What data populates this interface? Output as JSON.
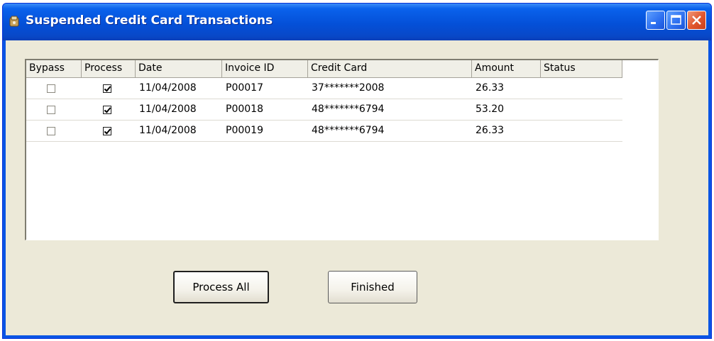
{
  "window": {
    "title": "Suspended Credit Card Transactions",
    "titlebar_color": "#0a55e4",
    "client_bg": "#ece9d8"
  },
  "titlebar_buttons": {
    "minimize_icon": "minimize-icon",
    "maximize_icon": "maximize-icon",
    "close_icon": "close-icon"
  },
  "grid": {
    "columns": [
      "Bypass",
      "Process",
      "Date",
      "Invoice ID",
      "Credit Card",
      "Amount",
      "Status"
    ],
    "rows": [
      {
        "bypass": false,
        "process": true,
        "date": "11/04/2008",
        "invoice_id": "P00017",
        "credit_card": "37*******2008",
        "amount": "26.33",
        "status": ""
      },
      {
        "bypass": false,
        "process": true,
        "date": "11/04/2008",
        "invoice_id": "P00018",
        "credit_card": "48*******6794",
        "amount": "53.20",
        "status": ""
      },
      {
        "bypass": false,
        "process": true,
        "date": "11/04/2008",
        "invoice_id": "P00019",
        "credit_card": "48*******6794",
        "amount": "26.33",
        "status": ""
      }
    ]
  },
  "buttons": {
    "process_all": "Process All",
    "finished": "Finished"
  }
}
